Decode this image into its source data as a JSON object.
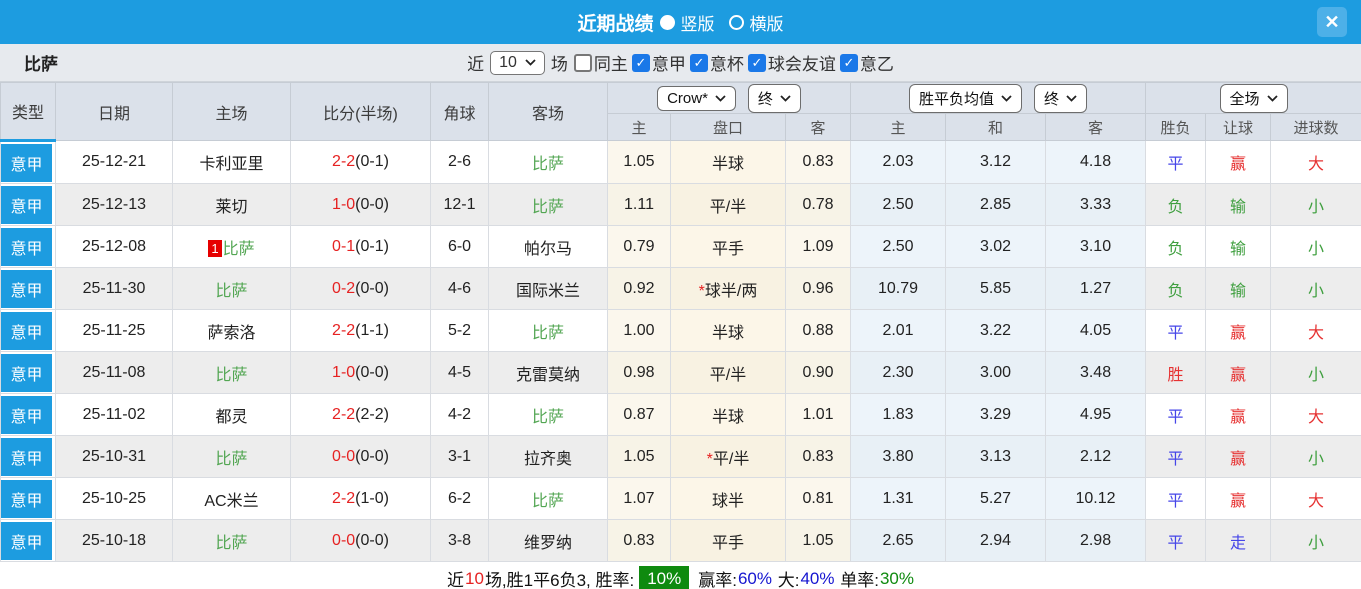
{
  "titlebar": {
    "title": "近期战绩",
    "radios": [
      {
        "label": "竖版",
        "selected": true
      },
      {
        "label": "横版",
        "selected": false
      }
    ],
    "close_glyph": "✕"
  },
  "filterbar": {
    "team": "比萨",
    "recent_label": "近",
    "count_value": "10",
    "games_label": "场",
    "checkboxes": [
      {
        "label": "同主",
        "checked": false
      },
      {
        "label": "意甲",
        "checked": true
      },
      {
        "label": "意杯",
        "checked": true
      },
      {
        "label": "球会友谊",
        "checked": true
      },
      {
        "label": "意乙",
        "checked": true
      }
    ]
  },
  "table": {
    "main_headers": [
      "类型",
      "日期",
      "主场",
      "比分(半场)",
      "角球",
      "客场"
    ],
    "dropdowns": {
      "odds_source": "Crow*",
      "odds_time": "终",
      "avg_source": "胜平负均值",
      "avg_time": "终",
      "scope": "全场"
    },
    "sub_headers": [
      "主",
      "盘口",
      "客",
      "主",
      "和",
      "客",
      "胜负",
      "让球",
      "进球数"
    ],
    "rows": [
      {
        "type": "意甲",
        "date": "25-12-21",
        "home": {
          "name": "卡利亚里",
          "green": false,
          "badge": ""
        },
        "score": "2-2",
        "half": "(0-1)",
        "corner": "2-6",
        "away": {
          "name": "比萨",
          "green": true,
          "badge": ""
        },
        "odds_home": "1.05",
        "handicap_star": false,
        "handicap": "半球",
        "odds_away": "0.83",
        "avg_home": "2.03",
        "avg_draw": "3.12",
        "avg_away": "4.18",
        "result": {
          "text": "平",
          "color": "blue"
        },
        "handicap_result": {
          "text": "赢",
          "color": "red"
        },
        "goals": {
          "text": "大",
          "color": "red"
        }
      },
      {
        "type": "意甲",
        "date": "25-12-13",
        "home": {
          "name": "莱切",
          "green": false,
          "badge": ""
        },
        "score": "1-0",
        "half": "(0-0)",
        "corner": "12-1",
        "away": {
          "name": "比萨",
          "green": true,
          "badge": ""
        },
        "odds_home": "1.11",
        "handicap_star": false,
        "handicap": "平/半",
        "odds_away": "0.78",
        "avg_home": "2.50",
        "avg_draw": "2.85",
        "avg_away": "3.33",
        "result": {
          "text": "负",
          "color": "green"
        },
        "handicap_result": {
          "text": "输",
          "color": "green"
        },
        "goals": {
          "text": "小",
          "color": "green"
        }
      },
      {
        "type": "意甲",
        "date": "25-12-08",
        "home": {
          "name": "比萨",
          "green": true,
          "badge": "1"
        },
        "score": "0-1",
        "half": "(0-1)",
        "corner": "6-0",
        "away": {
          "name": "帕尔马",
          "green": false,
          "badge": ""
        },
        "odds_home": "0.79",
        "handicap_star": false,
        "handicap": "平手",
        "odds_away": "1.09",
        "avg_home": "2.50",
        "avg_draw": "3.02",
        "avg_away": "3.10",
        "result": {
          "text": "负",
          "color": "green"
        },
        "handicap_result": {
          "text": "输",
          "color": "green"
        },
        "goals": {
          "text": "小",
          "color": "green"
        }
      },
      {
        "type": "意甲",
        "date": "25-11-30",
        "home": {
          "name": "比萨",
          "green": true,
          "badge": ""
        },
        "score": "0-2",
        "half": "(0-0)",
        "corner": "4-6",
        "away": {
          "name": "国际米兰",
          "green": false,
          "badge": ""
        },
        "odds_home": "0.92",
        "handicap_star": true,
        "handicap": "球半/两",
        "odds_away": "0.96",
        "avg_home": "10.79",
        "avg_draw": "5.85",
        "avg_away": "1.27",
        "result": {
          "text": "负",
          "color": "green"
        },
        "handicap_result": {
          "text": "输",
          "color": "green"
        },
        "goals": {
          "text": "小",
          "color": "green"
        }
      },
      {
        "type": "意甲",
        "date": "25-11-25",
        "home": {
          "name": "萨索洛",
          "green": false,
          "badge": ""
        },
        "score": "2-2",
        "half": "(1-1)",
        "corner": "5-2",
        "away": {
          "name": "比萨",
          "green": true,
          "badge": ""
        },
        "odds_home": "1.00",
        "handicap_star": false,
        "handicap": "半球",
        "odds_away": "0.88",
        "avg_home": "2.01",
        "avg_draw": "3.22",
        "avg_away": "4.05",
        "result": {
          "text": "平",
          "color": "blue"
        },
        "handicap_result": {
          "text": "赢",
          "color": "red"
        },
        "goals": {
          "text": "大",
          "color": "red"
        }
      },
      {
        "type": "意甲",
        "date": "25-11-08",
        "home": {
          "name": "比萨",
          "green": true,
          "badge": ""
        },
        "score": "1-0",
        "half": "(0-0)",
        "corner": "4-5",
        "away": {
          "name": "克雷莫纳",
          "green": false,
          "badge": ""
        },
        "odds_home": "0.98",
        "handicap_star": false,
        "handicap": "平/半",
        "odds_away": "0.90",
        "avg_home": "2.30",
        "avg_draw": "3.00",
        "avg_away": "3.48",
        "result": {
          "text": "胜",
          "color": "red"
        },
        "handicap_result": {
          "text": "赢",
          "color": "red"
        },
        "goals": {
          "text": "小",
          "color": "green"
        }
      },
      {
        "type": "意甲",
        "date": "25-11-02",
        "home": {
          "name": "都灵",
          "green": false,
          "badge": ""
        },
        "score": "2-2",
        "half": "(2-2)",
        "corner": "4-2",
        "away": {
          "name": "比萨",
          "green": true,
          "badge": ""
        },
        "odds_home": "0.87",
        "handicap_star": false,
        "handicap": "半球",
        "odds_away": "1.01",
        "avg_home": "1.83",
        "avg_draw": "3.29",
        "avg_away": "4.95",
        "result": {
          "text": "平",
          "color": "blue"
        },
        "handicap_result": {
          "text": "赢",
          "color": "red"
        },
        "goals": {
          "text": "大",
          "color": "red"
        }
      },
      {
        "type": "意甲",
        "date": "25-10-31",
        "home": {
          "name": "比萨",
          "green": true,
          "badge": ""
        },
        "score": "0-0",
        "half": "(0-0)",
        "corner": "3-1",
        "away": {
          "name": "拉齐奥",
          "green": false,
          "badge": ""
        },
        "odds_home": "1.05",
        "handicap_star": true,
        "handicap": "平/半",
        "odds_away": "0.83",
        "avg_home": "3.80",
        "avg_draw": "3.13",
        "avg_away": "2.12",
        "result": {
          "text": "平",
          "color": "blue"
        },
        "handicap_result": {
          "text": "赢",
          "color": "red"
        },
        "goals": {
          "text": "小",
          "color": "green"
        }
      },
      {
        "type": "意甲",
        "date": "25-10-25",
        "home": {
          "name": "AC米兰",
          "green": false,
          "badge": ""
        },
        "score": "2-2",
        "half": "(1-0)",
        "corner": "6-2",
        "away": {
          "name": "比萨",
          "green": true,
          "badge": ""
        },
        "odds_home": "1.07",
        "handicap_star": false,
        "handicap": "球半",
        "odds_away": "0.81",
        "avg_home": "1.31",
        "avg_draw": "5.27",
        "avg_away": "10.12",
        "result": {
          "text": "平",
          "color": "blue"
        },
        "handicap_result": {
          "text": "赢",
          "color": "red"
        },
        "goals": {
          "text": "大",
          "color": "red"
        }
      },
      {
        "type": "意甲",
        "date": "25-10-18",
        "home": {
          "name": "比萨",
          "green": true,
          "badge": ""
        },
        "score": "0-0",
        "half": "(0-0)",
        "corner": "3-8",
        "away": {
          "name": "维罗纳",
          "green": false,
          "badge": ""
        },
        "odds_home": "0.83",
        "handicap_star": false,
        "handicap": "平手",
        "odds_away": "1.05",
        "avg_home": "2.65",
        "avg_draw": "2.94",
        "avg_away": "2.98",
        "result": {
          "text": "平",
          "color": "blue"
        },
        "handicap_result": {
          "text": "走",
          "color": "blue"
        },
        "goals": {
          "text": "小",
          "color": "green"
        }
      }
    ]
  },
  "footer": {
    "segments": [
      {
        "text": "近",
        "style": "plain"
      },
      {
        "text": "10",
        "style": "red"
      },
      {
        "text": "场,胜1平6负3, 胜率:",
        "style": "plain"
      },
      {
        "text": "10%",
        "style": "greenbox"
      },
      {
        "text": "赢率:",
        "style": "plain"
      },
      {
        "text": "60%",
        "style": "blue"
      },
      {
        "text": " 大:",
        "style": "plain"
      },
      {
        "text": "40%",
        "style": "blue"
      },
      {
        "text": " 单率:",
        "style": "plain"
      },
      {
        "text": "30%",
        "style": "green"
      }
    ]
  }
}
